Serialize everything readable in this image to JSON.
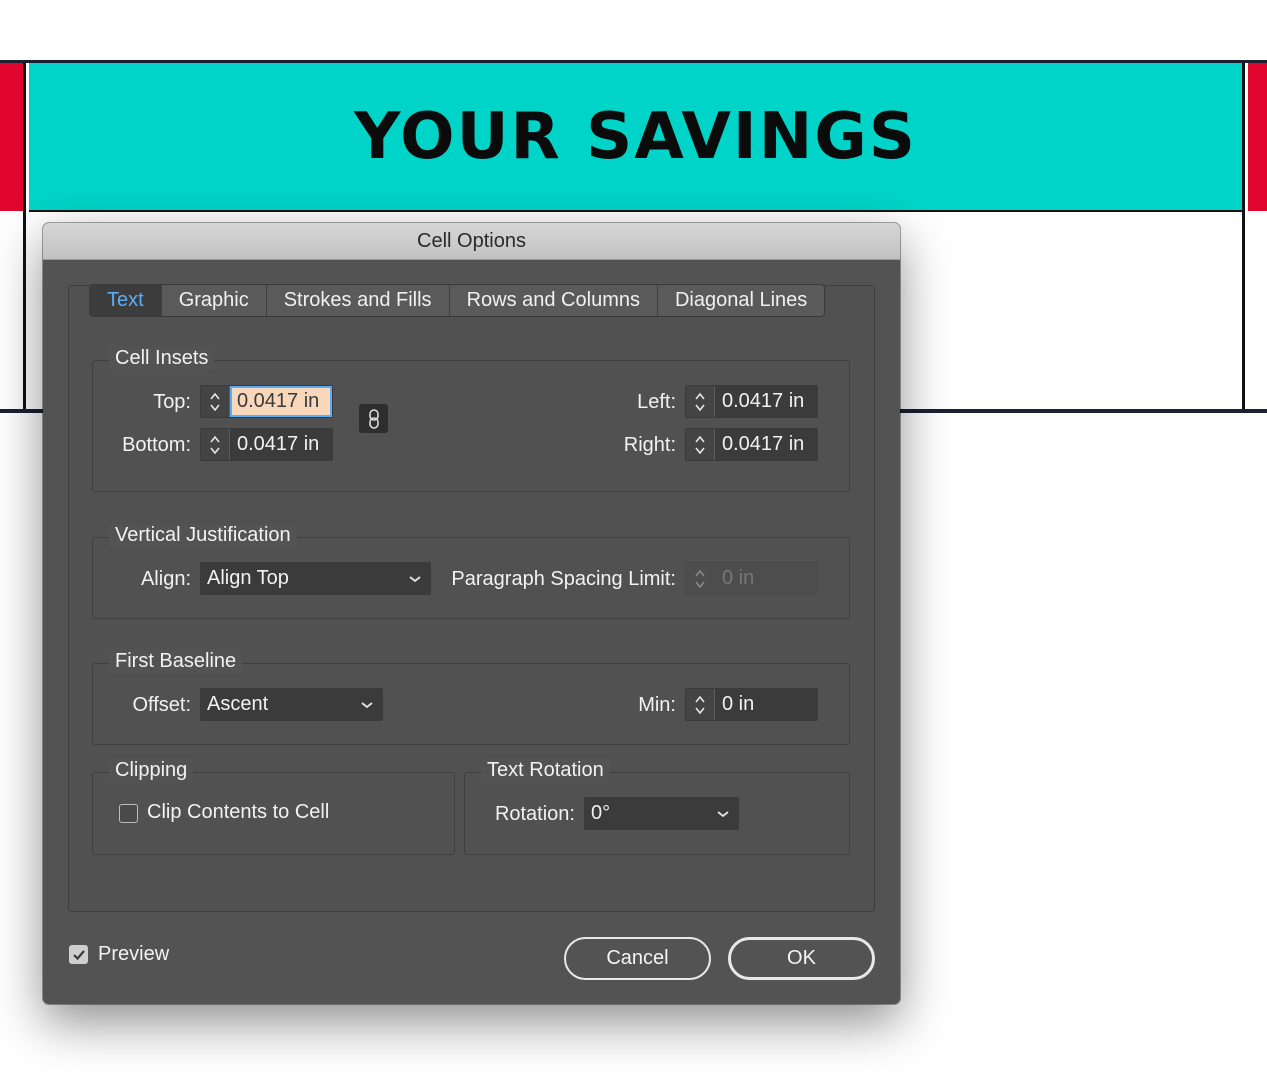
{
  "document": {
    "header_text": "YOUR SAVINGS",
    "colors": {
      "header_fill": "#00d4c8",
      "side_bars": "#e0062e",
      "lines": "#1c2030"
    }
  },
  "dialog": {
    "title": "Cell Options",
    "tabs": [
      {
        "label": "Text",
        "active": true
      },
      {
        "label": "Graphic",
        "active": false
      },
      {
        "label": "Strokes and Fills",
        "active": false
      },
      {
        "label": "Rows and Columns",
        "active": false
      },
      {
        "label": "Diagonal Lines",
        "active": false
      }
    ],
    "cell_insets": {
      "title": "Cell Insets",
      "top_label": "Top:",
      "top_value": "0.0417 in",
      "bottom_label": "Bottom:",
      "bottom_value": "0.0417 in",
      "left_label": "Left:",
      "left_value": "0.0417 in",
      "right_label": "Right:",
      "right_value": "0.0417 in",
      "link_icon": "chain-link-icon"
    },
    "vertical_justification": {
      "title": "Vertical Justification",
      "align_label": "Align:",
      "align_value": "Align Top",
      "spacing_label": "Paragraph Spacing Limit:",
      "spacing_value": "0 in"
    },
    "first_baseline": {
      "title": "First Baseline",
      "offset_label": "Offset:",
      "offset_value": "Ascent",
      "min_label": "Min:",
      "min_value": "0 in"
    },
    "clipping": {
      "title": "Clipping",
      "clip_label": "Clip Contents to Cell",
      "clip_checked": false
    },
    "text_rotation": {
      "title": "Text Rotation",
      "rotation_label": "Rotation:",
      "rotation_value": "0°"
    },
    "preview": {
      "label": "Preview",
      "checked": true
    },
    "buttons": {
      "cancel": "Cancel",
      "ok": "OK"
    },
    "accent_color": "#5aaef6",
    "focused_field_fill": "#f9d7ba"
  }
}
